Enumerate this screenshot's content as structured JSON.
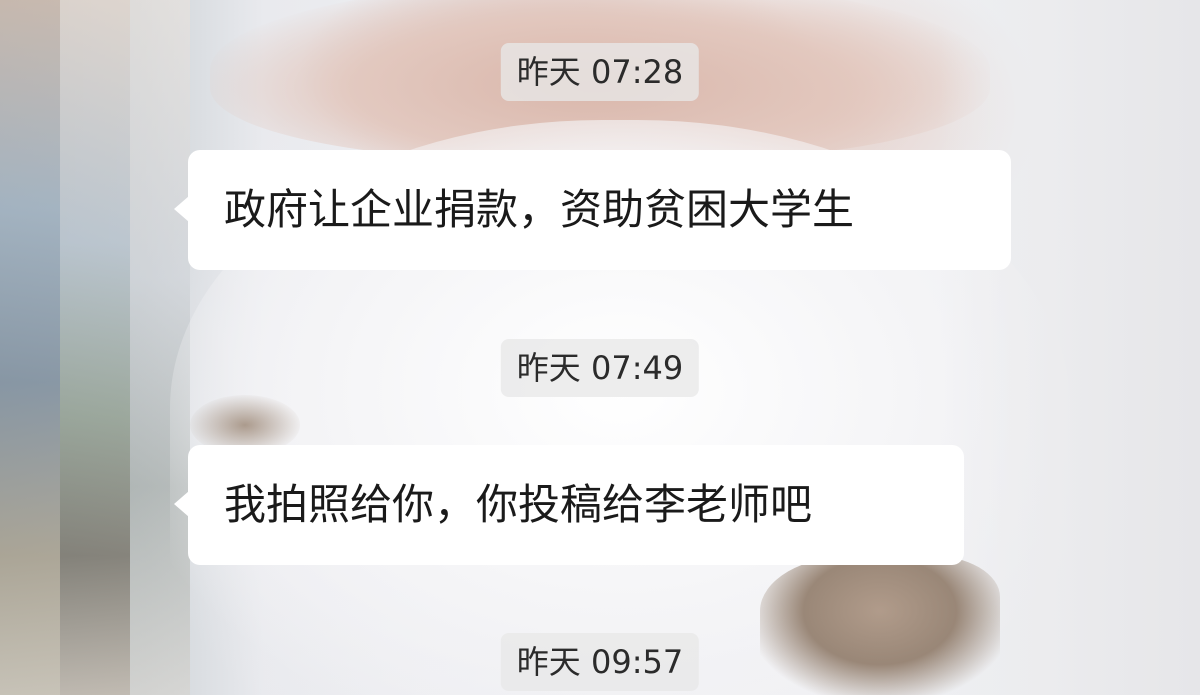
{
  "chat": {
    "messages": [
      {
        "time": "昨天 07:28",
        "text": "政府让企业捐款，资助贫困大学生"
      },
      {
        "time": "昨天 07:49",
        "text": "我拍照给你，你投稿给李老师吧"
      },
      {
        "time": "昨天 09:57"
      }
    ]
  },
  "colors": {
    "bubble_bg": "#ffffff",
    "timestamp_bg": "#e8e8e8",
    "text": "#1a1a1a"
  }
}
